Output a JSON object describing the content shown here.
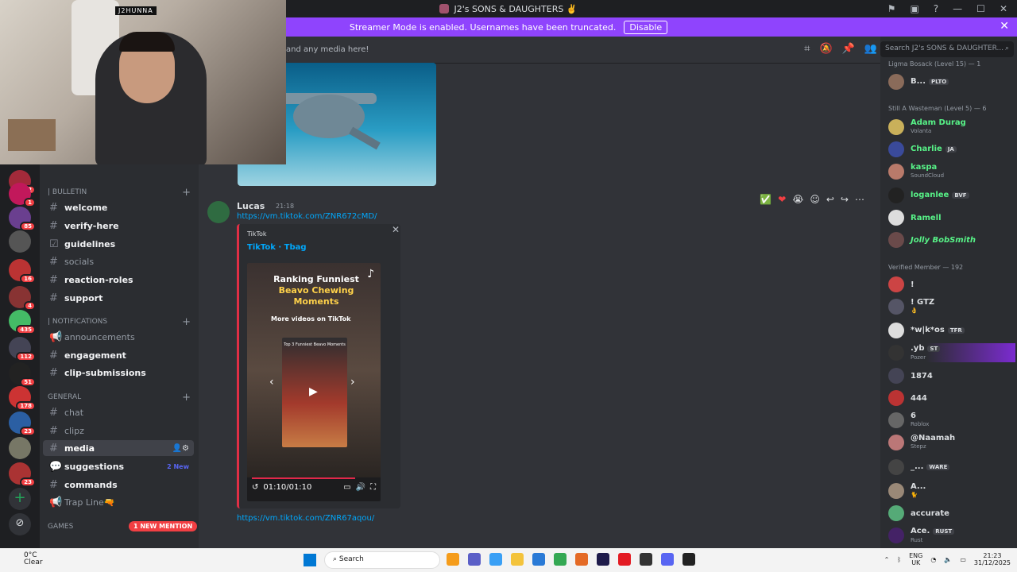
{
  "window": {
    "title": "J2's SONS & DAUGHTERS ✌️"
  },
  "banner": {
    "text": "Streamer Mode is enabled. Usernames have been truncated.",
    "button": "Disable"
  },
  "webcam": {
    "name_tag": "J2HUNNA"
  },
  "server_badges": [
    "112",
    "1",
    "85",
    "16",
    "4",
    "435",
    "112",
    "51",
    "178",
    "23",
    "23"
  ],
  "channel_sidebar": {
    "categories": [
      {
        "label": "| BULLETIN"
      },
      {
        "label": "| NOTIFICATIONS"
      },
      {
        "label": "GENERAL"
      },
      {
        "label": "GAMES"
      }
    ],
    "channels": [
      {
        "name": "welcome"
      },
      {
        "name": "verify-here"
      },
      {
        "name": "guidelines"
      },
      {
        "name": "socials"
      },
      {
        "name": "reaction-roles"
      },
      {
        "name": "support"
      },
      {
        "name": "announcements"
      },
      {
        "name": "engagement"
      },
      {
        "name": "clip-submissions"
      },
      {
        "name": "chat"
      },
      {
        "name": "clipz"
      },
      {
        "name": "media"
      },
      {
        "name": "suggestions",
        "extra": "2 New"
      },
      {
        "name": "commands"
      },
      {
        "name": "Trap Line🔫"
      }
    ],
    "mention_pill": "1 NEW MENTION"
  },
  "chat": {
    "topic": "and any media here!",
    "message": {
      "author": "Lucas",
      "time": "21:18",
      "link": "https://vm.tiktok.com/ZNR672cMD/",
      "embed": {
        "provider": "TikTok",
        "title": "TikTok · Tbag",
        "video": {
          "title_line1": "Ranking Funniest",
          "title_line2": "Beavo Chewing Moments",
          "more_videos": "More videos on TikTok",
          "thumb_text": "Top 3 Funniest Beavo Moments",
          "timecode": "01:10/01:10"
        }
      }
    },
    "next_link": "https://vm.tiktok.com/ZNR67aqou/"
  },
  "member_list": {
    "search_placeholder": "Search J2's SONS & DAUGHTER...",
    "groups": [
      {
        "title": "Ligma Bosack (Level 15) — 1"
      },
      {
        "title": "Still A Wasteman (Level 5) — 6"
      },
      {
        "title": "Verified Member — 192"
      }
    ],
    "members": [
      {
        "name": "B...",
        "tag": "PLTO",
        "sub": "",
        "color": "#dbdee1"
      },
      {
        "name": "Adam Durag",
        "tag": "",
        "sub": "Volanta",
        "color": "#57f287"
      },
      {
        "name": "Charlie",
        "tag": "JA",
        "sub": "",
        "color": "#57f287"
      },
      {
        "name": "kaspa",
        "tag": "",
        "sub": "SoundCloud",
        "color": "#57f287"
      },
      {
        "name": "loganlee",
        "tag": "BVF",
        "sub": "",
        "color": "#57f287"
      },
      {
        "name": "Ramell",
        "tag": "",
        "sub": "",
        "color": "#57f287"
      },
      {
        "name": "Jolly BobSmith",
        "tag": "",
        "sub": "",
        "color": "#57f287"
      },
      {
        "name": "!",
        "tag": "",
        "sub": "",
        "color": "#dbdee1"
      },
      {
        "name": "! GTZ",
        "tag": "",
        "sub": "👌",
        "color": "#dbdee1"
      },
      {
        "name": "*w|k*os",
        "tag": "TFR",
        "sub": "",
        "color": "#dbdee1"
      },
      {
        "name": ".yb",
        "tag": "ST",
        "sub": "Pozer",
        "color": "#dbdee1"
      },
      {
        "name": "1874",
        "tag": "",
        "sub": "",
        "color": "#dbdee1"
      },
      {
        "name": "444",
        "tag": "",
        "sub": "",
        "color": "#dbdee1"
      },
      {
        "name": "6",
        "tag": "",
        "sub": "Roblox",
        "color": "#dbdee1"
      },
      {
        "name": "@Naamah",
        "tag": "",
        "sub": "Stepz",
        "color": "#dbdee1"
      },
      {
        "name": "_...",
        "tag": "WARE",
        "sub": "",
        "color": "#dbdee1"
      },
      {
        "name": "A...",
        "tag": "",
        "sub": "🐈",
        "color": "#dbdee1"
      },
      {
        "name": "accurate",
        "tag": "",
        "sub": "",
        "color": "#dbdee1"
      },
      {
        "name": "Ace.",
        "tag": "RUST",
        "sub": "Rust",
        "color": "#dbdee1"
      }
    ]
  },
  "taskbar": {
    "temp": "0°C",
    "weather": "Clear",
    "search": "Search",
    "lang1": "ENG",
    "lang2": "UK",
    "time": "21:23",
    "date": "31/12/2025"
  }
}
